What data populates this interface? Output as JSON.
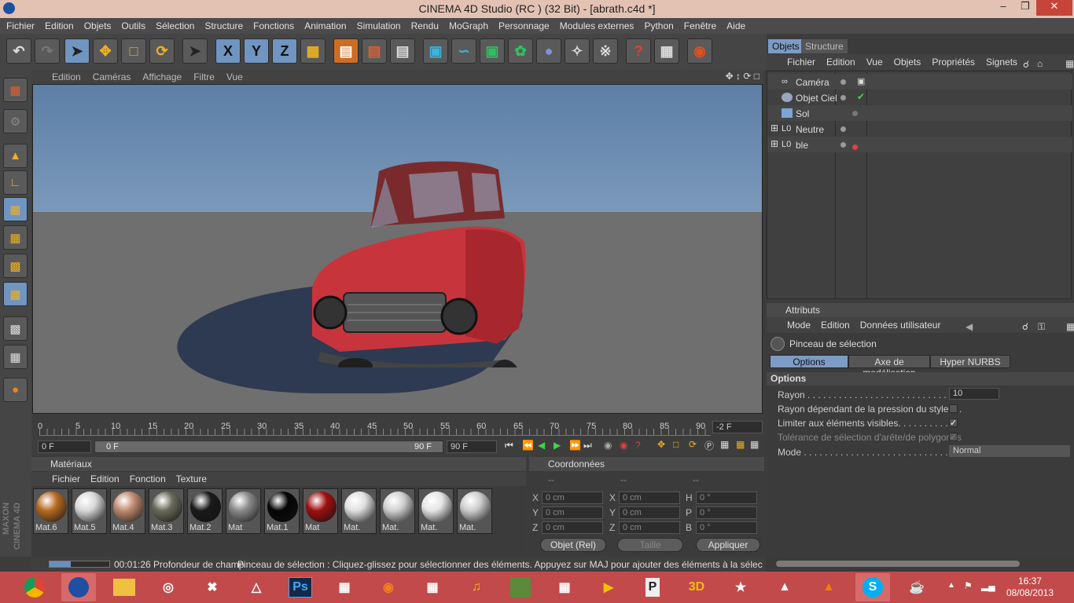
{
  "window": {
    "title": "CINEMA 4D Studio (RC ) (32 Bit) - [abrath.c4d *]"
  },
  "menubar": [
    "Fichier",
    "Edition",
    "Objets",
    "Outils",
    "Sélection",
    "Structure",
    "Fonctions",
    "Animation",
    "Simulation",
    "Rendu",
    "MoGraph",
    "Personnage",
    "Modules externes",
    "Python",
    "Fenêtre",
    "Aide"
  ],
  "viewport": {
    "menu": [
      "Edition",
      "Caméras",
      "Affichage",
      "Filtre",
      "Vue"
    ]
  },
  "timeline": {
    "ticks": [
      "0",
      "5",
      "10",
      "15",
      "20",
      "25",
      "30",
      "35",
      "40",
      "45",
      "50",
      "55",
      "60",
      "65",
      "70",
      "75",
      "80",
      "85",
      "90"
    ],
    "current_frame": "-2 F",
    "start_field": "0 F",
    "range_start": "0 F",
    "range_end": "90 F",
    "end_field": "90 F"
  },
  "materials": {
    "title": "Matériaux",
    "menu": [
      "Fichier",
      "Edition",
      "Fonction",
      "Texture"
    ],
    "items": [
      {
        "label": "Mat.6",
        "color": "#b86a22"
      },
      {
        "label": "Mat.5",
        "color": "#d8d8d8"
      },
      {
        "label": "Mat.4",
        "color": "#c08a70"
      },
      {
        "label": "Mat.3",
        "color": "#6a6a5a"
      },
      {
        "label": "Mat.2",
        "color": "#1a1a1a"
      },
      {
        "label": "Mat",
        "color": "#8a8a8a"
      },
      {
        "label": "Mat.1",
        "color": "#050505"
      },
      {
        "label": "Mat",
        "color": "#9e1010"
      },
      {
        "label": "Mat.",
        "color": "#e0e0e0"
      },
      {
        "label": "Mat.",
        "color": "#d0d0d0"
      },
      {
        "label": "Mat.",
        "color": "#e4e4e4"
      },
      {
        "label": "Mat.",
        "color": "#cccccc"
      }
    ]
  },
  "coordinates": {
    "title": "Coordonnées",
    "headers": [
      "--",
      "--",
      "--"
    ],
    "rows": [
      {
        "a": "X",
        "av": "0 cm",
        "b": "X",
        "bv": "0 cm",
        "c": "H",
        "cv": "0 °"
      },
      {
        "a": "Y",
        "av": "0 cm",
        "b": "Y",
        "bv": "0 cm",
        "c": "P",
        "cv": "0 °"
      },
      {
        "a": "Z",
        "av": "0 cm",
        "b": "Z",
        "bv": "0 cm",
        "c": "B",
        "cv": "0 °"
      }
    ],
    "mode_select": "Objet (Rel)",
    "size_select": "Taille",
    "apply_button": "Appliquer"
  },
  "statusbar": {
    "time": "00:01:26 Profondeur de champ",
    "message": "Pinceau de sélection : Cliquez-glissez pour sélectionner des éléments. Appuyez sur MAJ pour ajouter des éléments à la sélection ou CTRL pou"
  },
  "objects_panel": {
    "tabs": [
      "Objets",
      "Structure"
    ],
    "menu": [
      "Fichier",
      "Edition",
      "Vue",
      "Objets",
      "Propriétés",
      "Signets"
    ],
    "items": [
      {
        "name": "Caméra"
      },
      {
        "name": "Objet Ciel"
      },
      {
        "name": "Sol"
      },
      {
        "name": "Neutre"
      },
      {
        "name": "ble"
      }
    ]
  },
  "attributes": {
    "title": "Attributs",
    "menu": [
      "Mode",
      "Edition",
      "Données utilisateur"
    ],
    "tool_name": "Pinceau de sélection",
    "tabs": [
      "Options",
      "Axe de modélisation",
      "Hyper NURBS"
    ],
    "section": "Options",
    "fields": {
      "rayon_label": "Rayon . . . . . . . . . . . . . . . . . . . . . . . . . . . . . . .",
      "rayon_value": "10",
      "pression_label": "Rayon dépendant de la pression du stylet . .",
      "visibles_label": "Limiter aux éléments visibles. . . . . . . . . . . .",
      "tolerance_label": "Tolérance de sélection d'arête/de polygones",
      "mode_label": "Mode . . . . . . . . . . . . . . . . . . . . . . . . . . . . . . .",
      "mode_value": "Normal"
    }
  },
  "taskbar": {
    "time": "16:37",
    "date": "08/08/2013"
  },
  "colors": {
    "accent_blue": "#7d9cc5",
    "taskbar": "#c24a4a",
    "car_red": "#c8343c"
  }
}
